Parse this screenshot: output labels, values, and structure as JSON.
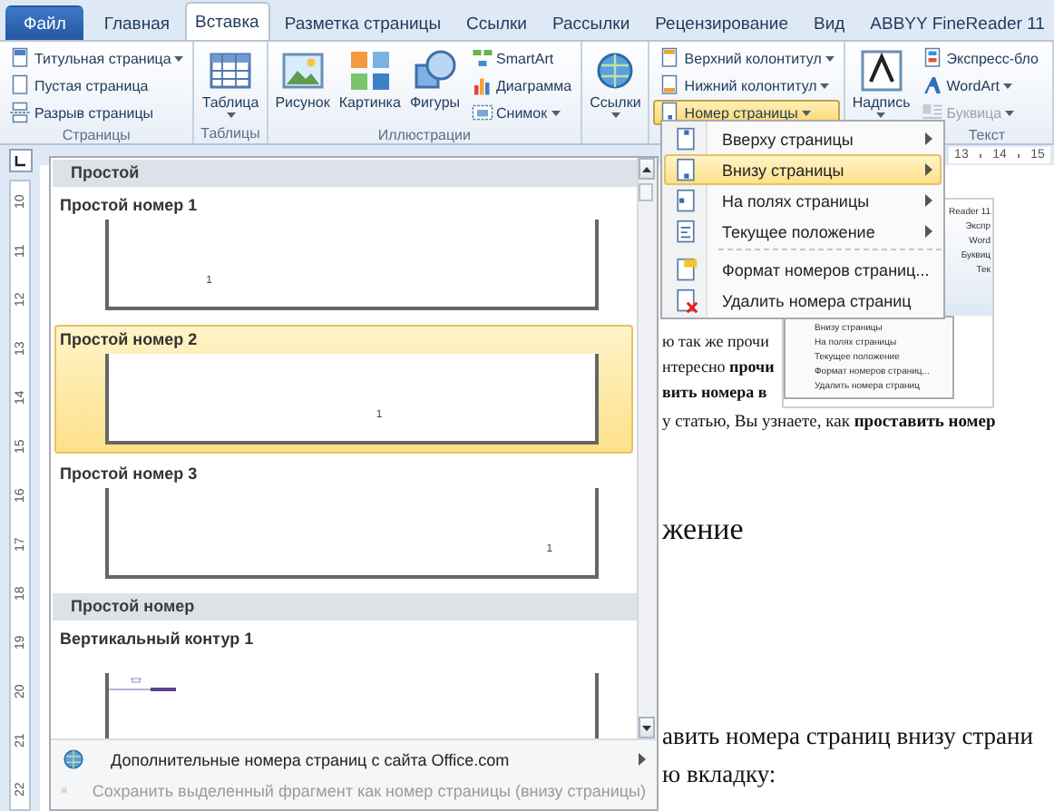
{
  "tabs": [
    {
      "label": "Файл",
      "kind": "file",
      "selected": false
    },
    {
      "label": "Главная",
      "kind": "tab",
      "selected": false
    },
    {
      "label": "Вставка",
      "kind": "tab",
      "selected": true
    },
    {
      "label": "Разметка страницы",
      "kind": "tab",
      "selected": false
    },
    {
      "label": "Ссылки",
      "kind": "tab",
      "selected": false
    },
    {
      "label": "Рассылки",
      "kind": "tab",
      "selected": false
    },
    {
      "label": "Рецензирование",
      "kind": "tab",
      "selected": false
    },
    {
      "label": "Вид",
      "kind": "tab",
      "selected": false
    },
    {
      "label": "ABBYY FineReader 11",
      "kind": "tab",
      "selected": false
    }
  ],
  "ribbon": {
    "groups": [
      {
        "label": "Страницы",
        "items": [
          {
            "kind": "small",
            "label": "Титульная страница",
            "dropdown": true,
            "pressed": false,
            "disabled": false
          },
          {
            "kind": "small",
            "label": "Пустая страница",
            "dropdown": false,
            "pressed": false,
            "disabled": false
          },
          {
            "kind": "small",
            "label": "Разрыв страницы",
            "dropdown": false,
            "pressed": false,
            "disabled": false
          }
        ]
      },
      {
        "label": "Таблицы",
        "items": [
          {
            "kind": "large",
            "label": "Таблица",
            "dropdown": true,
            "pressed": false,
            "disabled": false
          }
        ]
      },
      {
        "label": "Иллюстрации",
        "items": [
          {
            "kind": "large",
            "label": "Рисунок",
            "dropdown": false,
            "pressed": false,
            "disabled": false
          },
          {
            "kind": "large",
            "label": "Картинка",
            "dropdown": false,
            "pressed": false,
            "disabled": false
          },
          {
            "kind": "large",
            "label": "Фигуры",
            "dropdown": false,
            "pressed": false,
            "disabled": false
          },
          {
            "kind": "small",
            "label": "SmartArt",
            "dropdown": false,
            "pressed": false,
            "disabled": false
          },
          {
            "kind": "small",
            "label": "Диаграмма",
            "dropdown": false,
            "pressed": false,
            "disabled": false
          },
          {
            "kind": "small",
            "label": "Снимок",
            "dropdown": true,
            "pressed": false,
            "disabled": false
          }
        ]
      },
      {
        "items": [
          {
            "kind": "large",
            "label": "Ссылки",
            "dropdown": true,
            "pressed": false,
            "disabled": false
          }
        ]
      },
      {
        "items": [
          {
            "kind": "small",
            "label": "Верхний колонтитул",
            "dropdown": true,
            "pressed": false,
            "disabled": false
          },
          {
            "kind": "small",
            "label": "Нижний колонтитул",
            "dropdown": true,
            "pressed": false,
            "disabled": false
          },
          {
            "kind": "small",
            "label": "Номер страницы",
            "dropdown": true,
            "pressed": true,
            "disabled": false
          }
        ]
      },
      {
        "label": "Текст",
        "items": [
          {
            "kind": "large",
            "label": "Надпись",
            "dropdown": true,
            "pressed": false,
            "disabled": false
          },
          {
            "kind": "small",
            "label": "Экспресс-бло",
            "dropdown": false,
            "pressed": false,
            "disabled": false
          },
          {
            "kind": "small",
            "label": "WordArt",
            "dropdown": true,
            "pressed": false,
            "disabled": false
          },
          {
            "kind": "small",
            "label": "Буквица",
            "dropdown": true,
            "pressed": false,
            "disabled": true
          }
        ]
      }
    ]
  },
  "ruler": {
    "numbers": [
      "13",
      "14",
      "15"
    ]
  },
  "vertical_ruler": {
    "numbers": [
      "10",
      "11",
      "12",
      "13",
      "14",
      "15",
      "16",
      "17",
      "18",
      "19",
      "20",
      "21",
      "22"
    ]
  },
  "document": {
    "wrapped_lines": [
      "ю так же прочи",
      "нтересно **прочи**",
      "**вить номера в**"
    ],
    "embedded_screenshot": {
      "ribbon_labels": [
        "Reader 11",
        "Экспр",
        "Word",
        "Буквиц",
        "Тек"
      ],
      "menu_items": [
        "Внизу страницы",
        "На полях страницы",
        "Текущее положение",
        "Формат номеров страниц...",
        "Удалить номера страниц"
      ]
    },
    "lines": [
      {
        "kind": "small",
        "text": "у статью, Вы узнаете, как **проставить номер**"
      },
      {
        "kind": "heading",
        "text": "жение"
      },
      {
        "kind": "body",
        "text": "авить номера страниц внизу страни"
      },
      {
        "kind": "body",
        "text": "ю вкладку:"
      }
    ]
  },
  "gallery": {
    "sections": [
      {
        "title": "Простой",
        "items": [
          {
            "label": "Простой номер 1",
            "number": "1",
            "kind": "number",
            "selected": false
          },
          {
            "label": "Простой номер 2",
            "number": "1",
            "kind": "number",
            "selected": true
          },
          {
            "label": "Простой номер 3",
            "number": "1",
            "kind": "number",
            "selected": false
          }
        ]
      },
      {
        "title": "Простой номер",
        "items": [
          {
            "label": "Вертикальный контур 1",
            "kind": "contour",
            "selected": false
          }
        ]
      }
    ],
    "footer": [
      {
        "label": "Дополнительные номера страниц с сайта Office.com",
        "submenu": true,
        "disabled": false
      },
      {
        "label": "Сохранить выделенный фрагмент как номер страницы (внизу страницы)",
        "submenu": false,
        "disabled": true
      }
    ]
  },
  "submenu": {
    "items": [
      {
        "label": "Вверху страницы",
        "kind": "submenu",
        "selected": false
      },
      {
        "label": "Внизу страницы",
        "kind": "submenu",
        "selected": true
      },
      {
        "label": "На полях страницы",
        "kind": "submenu",
        "selected": false
      },
      {
        "label": "Текущее положение",
        "kind": "submenu",
        "selected": false
      },
      {
        "label": "Формат номеров страниц...",
        "kind": "command",
        "selected": false
      },
      {
        "label": "Удалить номера страниц",
        "kind": "command",
        "selected": false
      }
    ]
  }
}
